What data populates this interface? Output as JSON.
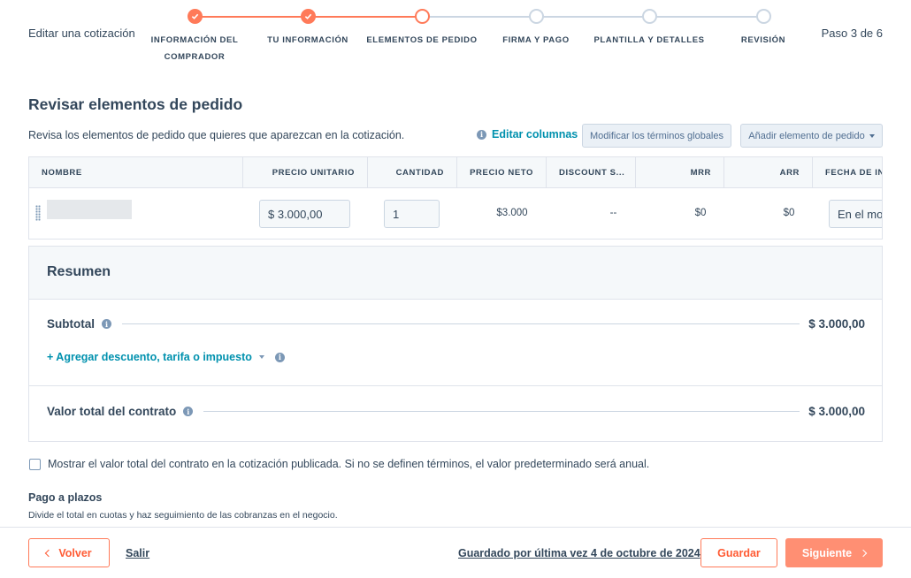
{
  "header": {
    "title": "Editar una cotización",
    "step_count": "Paso 3 de 6",
    "steps": [
      {
        "label": "Información del comprador",
        "state": "done"
      },
      {
        "label": "Tu información",
        "state": "done"
      },
      {
        "label": "Elementos de pedido",
        "state": "current"
      },
      {
        "label": "Firma y pago",
        "state": "pending"
      },
      {
        "label": "Plantilla y detalles",
        "state": "pending"
      },
      {
        "label": "Revisión",
        "state": "pending"
      }
    ]
  },
  "section": {
    "title": "Revisar elementos de pedido",
    "description": "Revisa los elementos de pedido que quieres que aparezcan en la cotización.",
    "edit_columns": "Editar columnas",
    "modify_terms": "Modificar los términos globales",
    "add_item": "Añadir elemento de pedido"
  },
  "table": {
    "columns": [
      "NOMBRE",
      "PRECIO UNITARIO",
      "CANTIDAD",
      "PRECIO NETO",
      "DISCOUNT S...",
      "MRR",
      "ARR",
      "FECHA DE IN"
    ],
    "row": {
      "unit_price": "$ 3.000,00",
      "quantity": "1",
      "net_price": "$3.000",
      "discount": "--",
      "mrr": "$0",
      "arr": "$0",
      "start_date": "En el mo"
    }
  },
  "summary": {
    "title": "Resumen",
    "subtotal_label": "Subtotal",
    "subtotal_value": "$ 3.000,00",
    "add_discount": "+ Agregar descuento, tarifa o impuesto",
    "total_label": "Valor total del contrato",
    "total_value": "$ 3.000,00"
  },
  "options": {
    "show_total_label": "Mostrar el valor total del contrato en la cotización publicada. Si no se definen términos, el valor predeterminado será anual.",
    "show_total_checked": false,
    "installments_title": "Pago a plazos",
    "installments_desc": "Divide el total en cuotas y haz seguimiento de las cobranzas en el negocio."
  },
  "footer": {
    "back": "Volver",
    "exit": "Salir",
    "saved": "Guardado por última vez 4 de octubre de 2024",
    "save": "Guardar",
    "next": "Siguiente"
  },
  "colors": {
    "accent": "#ff7a59",
    "link": "#0091ae",
    "text": "#33475b"
  }
}
